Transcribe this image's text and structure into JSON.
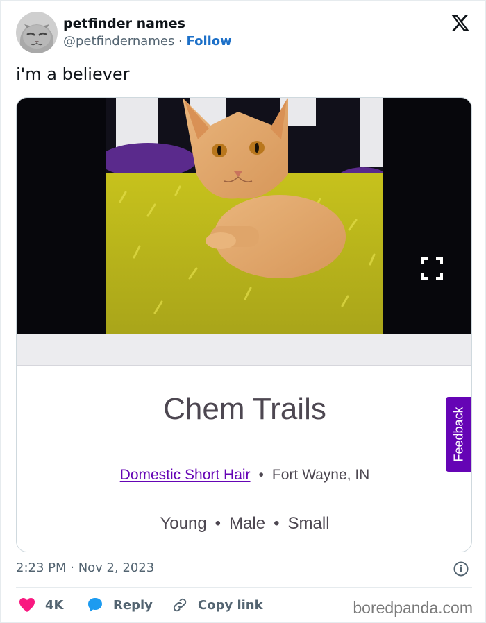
{
  "tweet": {
    "display_name": "petfinder names",
    "handle": "@petfindernames",
    "separator": "·",
    "follow_label": "Follow",
    "text": "i'm a believer",
    "timestamp": "2:23 PM · Nov 2, 2023"
  },
  "listing": {
    "pet_name": "Chem Trails",
    "breed": "Domestic Short Hair",
    "bullet": "•",
    "location": "Fort Wayne, IN",
    "age": "Young",
    "sex": "Male",
    "size": "Small",
    "feedback_label": "Feedback"
  },
  "actions": {
    "like_count": "4K",
    "reply_label": "Reply",
    "copy_label": "Copy link"
  },
  "watermark": "boredpanda.com",
  "colors": {
    "follow_blue": "#1d70c8",
    "petfinder_purple": "#6504b5",
    "like_pink": "#f91880",
    "reply_blue": "#1d9bf0"
  },
  "icons": [
    "x-logo-icon",
    "expand-icon",
    "info-icon",
    "heart-icon",
    "reply-bubble-icon",
    "link-icon"
  ]
}
